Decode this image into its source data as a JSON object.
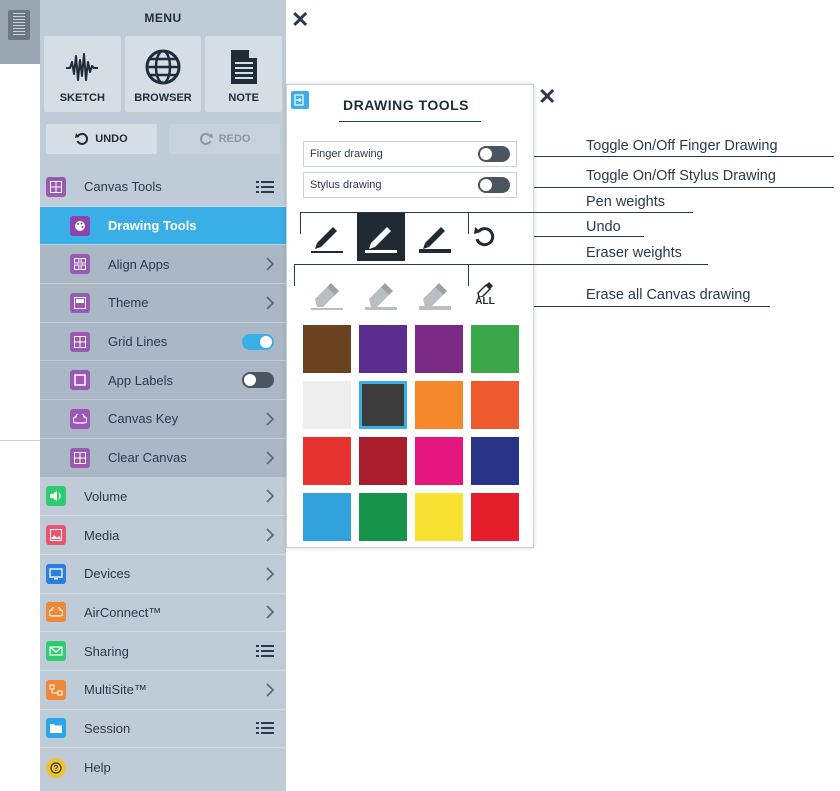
{
  "menu": {
    "title": "MENU",
    "apps": [
      {
        "label": "SKETCH",
        "icon": "sketch-wave-icon"
      },
      {
        "label": "BROWSER",
        "icon": "globe-icon"
      },
      {
        "label": "NOTE",
        "icon": "note-document-icon"
      }
    ],
    "undo_label": "UNDO",
    "redo_label": "REDO",
    "items": [
      {
        "label": "Canvas Tools",
        "icon": "grid-icon",
        "trail": "list"
      },
      {
        "label": "Drawing Tools",
        "icon": "palette-icon",
        "active": true
      },
      {
        "label": "Align Apps",
        "icon": "align-grid-icon",
        "trail": "chevron"
      },
      {
        "label": "Theme",
        "icon": "theme-icon",
        "trail": "chevron"
      },
      {
        "label": "Grid Lines",
        "icon": "grid-lines-icon",
        "trail": "toggle-on"
      },
      {
        "label": "App Labels",
        "icon": "label-icon",
        "trail": "toggle-off"
      },
      {
        "label": "Canvas Key",
        "icon": "cloud-key-icon",
        "trail": "chevron"
      },
      {
        "label": "Clear Canvas",
        "icon": "clear-grid-icon",
        "trail": "chevron"
      },
      {
        "label": "Volume",
        "icon": "speaker-icon",
        "trail": "chevron"
      },
      {
        "label": "Media",
        "icon": "image-icon",
        "trail": "chevron"
      },
      {
        "label": "Devices",
        "icon": "monitor-icon",
        "trail": "chevron"
      },
      {
        "label": "AirConnect™",
        "icon": "cloud-icon",
        "trail": "chevron"
      },
      {
        "label": "Sharing",
        "icon": "envelope-icon",
        "trail": "list"
      },
      {
        "label": "MultiSite™",
        "icon": "network-icon",
        "trail": "chevron"
      },
      {
        "label": "Session",
        "icon": "folder-icon",
        "trail": "list"
      },
      {
        "label": "Help",
        "icon": "question-icon"
      }
    ]
  },
  "drawing_tools": {
    "title": "DRAWING TOOLS",
    "finger_label": "Finger drawing",
    "stylus_label": "Stylus drawing",
    "erase_all_label": "ALL",
    "swatches": [
      "#6b4220",
      "#5a2d8e",
      "#7b2a86",
      "#3aa84a",
      "#eeeeee",
      "#3c3c3c",
      "#f5882a",
      "#ee5a2e",
      "#e6332f",
      "#a91d2d",
      "#e4177f",
      "#2a3487",
      "#31a2dc",
      "#17924a",
      "#f7e232",
      "#e41f2b"
    ],
    "selected_swatch": 5
  },
  "callouts": [
    "Toggle On/Off Finger Drawing",
    "Toggle On/Off Stylus Drawing",
    "Pen weights",
    "Undo",
    "Eraser weights",
    "Erase all Canvas drawing"
  ],
  "colors": {
    "accent": "#3aaee6",
    "panel": "#bfcbd6",
    "submenu": "#aab8c5"
  }
}
